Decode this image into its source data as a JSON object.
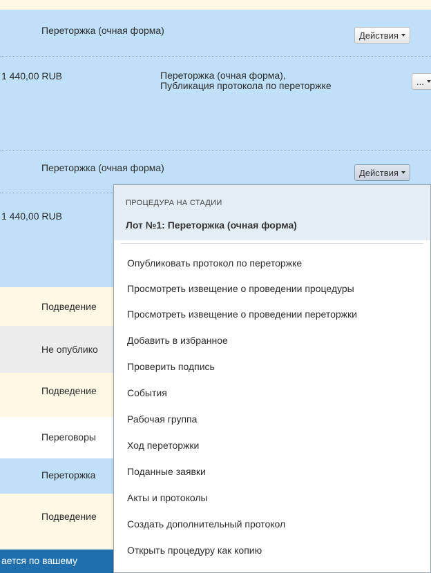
{
  "rows": {
    "r1_stage": "Переторжка (очная форма)",
    "r1_action": "Действия",
    "r2_price": "1 440,00 RUB",
    "r2_stage": "Переторжка (очная форма), Публикация протокола по переторжке",
    "r2_action": "...",
    "r3_stage": "Переторжка (очная форма)",
    "r3_action": "Действия",
    "r4_price": "1 440,00 RUB",
    "r5_stage": "Подведение",
    "r6_stage": "Не опублико",
    "r7_stage": "Подведение",
    "r8_stage": "Переговоры",
    "r9_stage": "Переторжка",
    "r10_stage": "Подведение"
  },
  "statusbar": {
    "text": "ается по вашему"
  },
  "dropdown": {
    "caption": "ПРОЦЕДУРА НА СТАДИИ",
    "title": "Лот №1: Переторжка (очная форма)",
    "items": [
      "Опубликовать протокол по переторжке",
      "Просмотреть извещение о проведении процедуры",
      "Просмотреть извещение о проведении переторжки",
      "Добавить в избранное",
      "Проверить подпись",
      "События",
      "Рабочая группа",
      "Ход переторжки",
      "Поданные заявки",
      "Акты и протоколы",
      "Создать дополнительный протокол",
      "Открыть процедуру как копию"
    ]
  },
  "colors": {
    "row_blue": "#bfe0f8",
    "row_cream": "#fef8e4",
    "row_gray": "#ececec",
    "statusbar": "#1f6fae",
    "menu_header": "#e4ecf4"
  },
  "icons": {
    "dropdown_caret": "caret-down-icon"
  }
}
